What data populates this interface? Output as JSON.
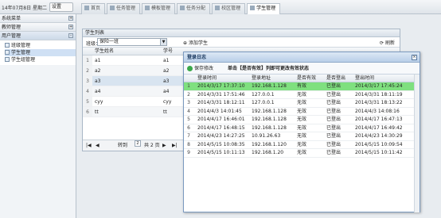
{
  "header": {
    "date": "14年07月8日 星期二",
    "settings_label": "设置",
    "tabs": [
      "首页",
      "任务管理",
      "模板管理",
      "任务分配",
      "校区管理",
      "学生管理"
    ]
  },
  "sidebar": {
    "sections": [
      "系统菜单",
      "教师管理",
      "用户管理"
    ],
    "tree": [
      "班级管理",
      "学生管理",
      "学生组管理"
    ]
  },
  "student_panel": {
    "title": "学生列表",
    "class_label": "班级：",
    "class_value": "保险一班",
    "add_label": "添加学生",
    "refresh_label": "刷新",
    "columns": [
      "学生姓名",
      "学号"
    ],
    "rows": [
      {
        "n": "1",
        "name": "a1",
        "id": "a1"
      },
      {
        "n": "2",
        "name": "a2",
        "id": "a2"
      },
      {
        "n": "3",
        "name": "a3",
        "id": "a3"
      },
      {
        "n": "4",
        "name": "a4",
        "id": "a4"
      },
      {
        "n": "5",
        "name": "cyy",
        "id": "cyy"
      },
      {
        "n": "6",
        "name": "tt",
        "id": "tt"
      }
    ],
    "pager": {
      "page_prefix": "转到",
      "page": "2",
      "total": "共 2 页"
    }
  },
  "dialog": {
    "title": "登录日志",
    "save_label": "保存修改",
    "hint": "单击【是否有效】列即可更改有效状态",
    "columns": [
      "登录时间",
      "登录地址",
      "是否有效",
      "是否登出",
      "登出时间"
    ],
    "rows": [
      {
        "n": "1",
        "login": "2014/3/17 17:37:10",
        "ip": "192.168.1.128",
        "valid": "有效",
        "out": "已登出",
        "logout": "2014/3/17 17:45:24"
      },
      {
        "n": "2",
        "login": "2014/3/31 17:51:46",
        "ip": "127.0.0.1",
        "valid": "无效",
        "out": "已登出",
        "logout": "2014/3/31 18:11:19"
      },
      {
        "n": "3",
        "login": "2014/3/31 18:12:11",
        "ip": "127.0.0.1",
        "valid": "无效",
        "out": "已登出",
        "logout": "2014/3/31 18:13:22"
      },
      {
        "n": "4",
        "login": "2014/4/3 14:01:45",
        "ip": "192.168.1.128",
        "valid": "无效",
        "out": "已登出",
        "logout": "2014/4/3 14:08:16"
      },
      {
        "n": "5",
        "login": "2014/4/17 16:46:01",
        "ip": "192.168.1.128",
        "valid": "无效",
        "out": "已登出",
        "logout": "2014/4/17 16:47:13"
      },
      {
        "n": "6",
        "login": "2014/4/17 16:48:15",
        "ip": "192.168.1.128",
        "valid": "无效",
        "out": "已登出",
        "logout": "2014/4/17 16:49:42"
      },
      {
        "n": "7",
        "login": "2014/4/23 14:27:25",
        "ip": "10.91.26.63",
        "valid": "无效",
        "out": "已登出",
        "logout": "2014/4/23 14:30:29"
      },
      {
        "n": "8",
        "login": "2014/5/15 10:08:35",
        "ip": "192.168.1.120",
        "valid": "无效",
        "out": "已登出",
        "logout": "2014/5/15 10:09:54"
      },
      {
        "n": "9",
        "login": "2014/5/15 10:11:13",
        "ip": "192.168.1.20",
        "valid": "无效",
        "out": "已登出",
        "logout": "2014/5/15 10:11:42"
      }
    ]
  }
}
